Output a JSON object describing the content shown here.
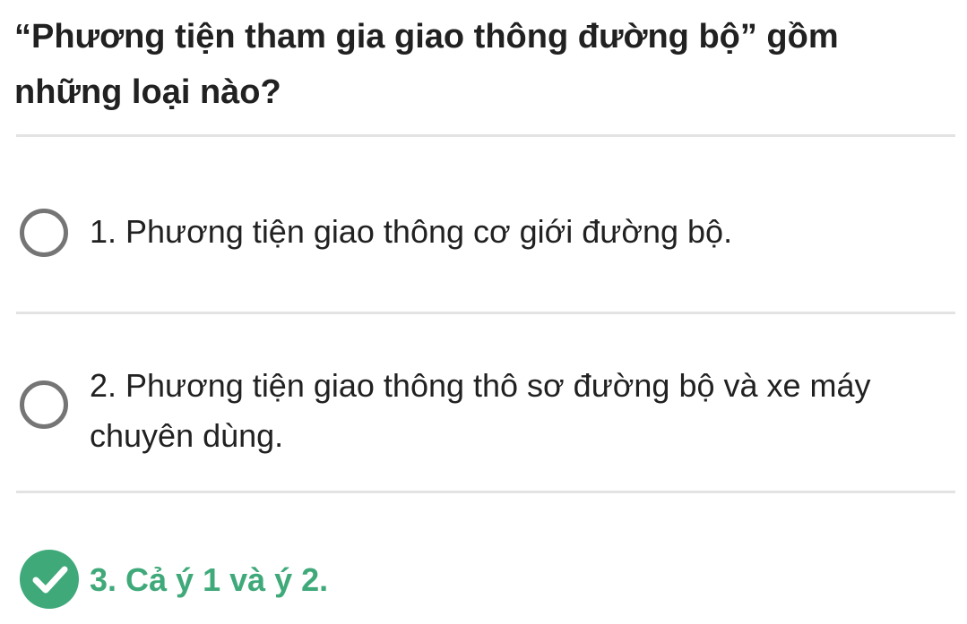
{
  "question": {
    "text": "“Phương tiện tham gia giao thông đường bộ” gồm những loại nào?"
  },
  "options": [
    {
      "label": "1. Phương tiện giao thông cơ giới đường bộ.",
      "selected": false,
      "correct": false
    },
    {
      "label": "2. Phương tiện giao thông thô sơ đường bộ và xe máy chuyên dùng.",
      "selected": false,
      "correct": false
    },
    {
      "label": "3. Cả ý 1 và ý 2.",
      "selected": true,
      "correct": true
    }
  ],
  "colors": {
    "correct": "#3fa97a",
    "radio_border": "#757575",
    "divider": "#e3e3e3",
    "text": "#212121"
  },
  "icons": {
    "unselected": "radio-unchecked-icon",
    "selected": "check-circle-icon"
  }
}
